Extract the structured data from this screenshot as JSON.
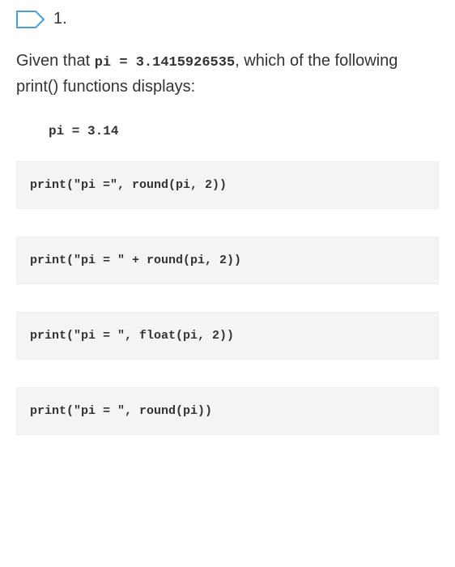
{
  "header": {
    "number": "1."
  },
  "question": {
    "prefix": "Given that ",
    "code1": "pi = 3.1415926535",
    "middle": ", which of the following print() functions displays:"
  },
  "expected_output": "pi = 3.14",
  "options": [
    "print(\"pi =\", round(pi, 2))",
    "print(\"pi = \" + round(pi, 2))",
    "print(\"pi = \", float(pi, 2))",
    "print(\"pi = \", round(pi))"
  ]
}
